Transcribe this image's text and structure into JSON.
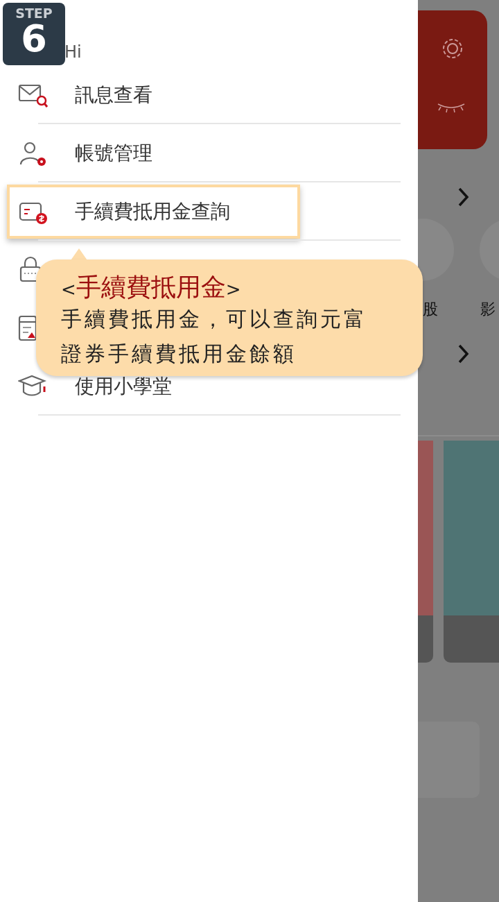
{
  "step_badge": {
    "label": "STEP",
    "number": "6"
  },
  "drawer": {
    "greeting": "Hi",
    "items": [
      {
        "label": "訊息查看",
        "highlighted": false
      },
      {
        "label": "帳號管理",
        "highlighted": false
      },
      {
        "label": "手續費抵用金查詢",
        "highlighted": true
      },
      {
        "highlighted": false
      },
      {
        "highlighted": false
      },
      {
        "label": "使用小學堂",
        "highlighted": false
      }
    ]
  },
  "tooltip": {
    "open_mark": "<",
    "title": "手續費抵用金",
    "close_mark": ">",
    "body": "手續費抵用金，可以查詢元富證券手續費抵用金餘額"
  },
  "background_app": {
    "shortcut_labels": [
      "股",
      "影"
    ]
  }
}
